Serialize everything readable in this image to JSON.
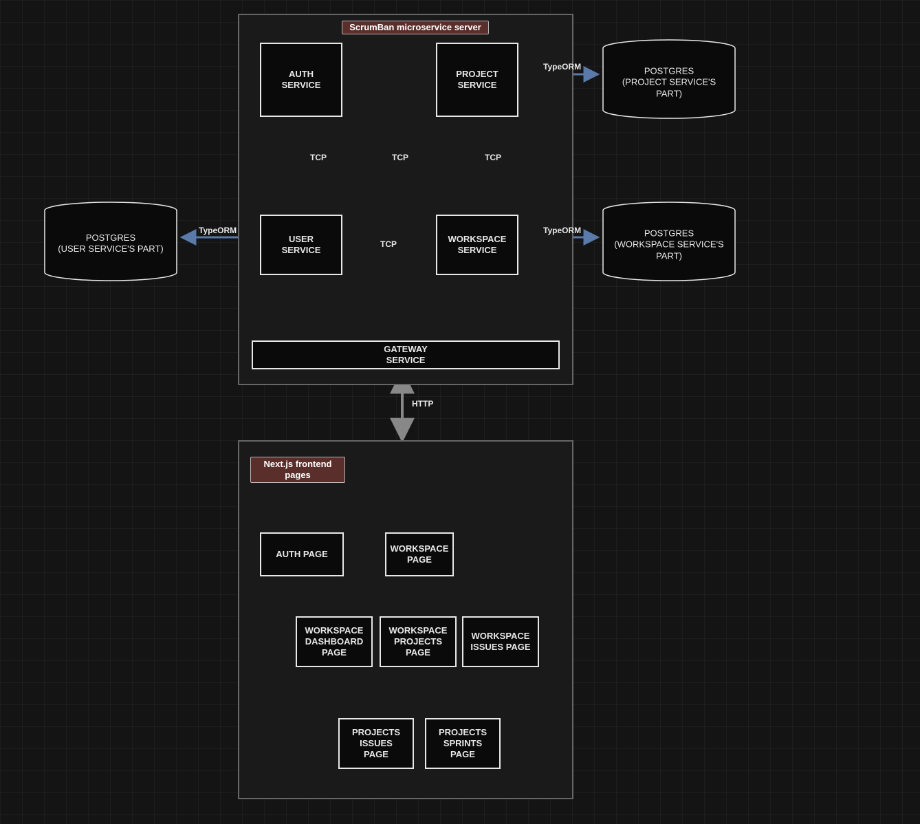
{
  "containers": {
    "server": {
      "title": "ScrumBan microservice server"
    },
    "frontend": {
      "title": "Next.js frontend pages"
    }
  },
  "services": {
    "auth": {
      "label": "AUTH\nSERVICE"
    },
    "project": {
      "label": "PROJECT\nSERVICE"
    },
    "user": {
      "label": "USER\nSERVICE"
    },
    "workspace": {
      "label": "WORKSPACE\nSERVICE"
    },
    "gateway": {
      "label": "GATEWAY\nSERVICE"
    }
  },
  "pages": {
    "auth": {
      "label": "AUTH PAGE"
    },
    "workspace": {
      "label": "WORKSPACE\nPAGE"
    },
    "ws_dashboard": {
      "label": "WORKSPACE\nDASHBOARD\nPAGE"
    },
    "ws_projects": {
      "label": "WORKSPACE\nPROJECTS\nPAGE"
    },
    "ws_issues": {
      "label": "WORKSPACE\nISSUES PAGE"
    },
    "proj_issues": {
      "label": "PROJECTS\nISSUES\nPAGE"
    },
    "proj_sprints": {
      "label": "PROJECTS\nSPRINTS\nPAGE"
    }
  },
  "databases": {
    "project": {
      "label": "POSTGRES\n(PROJECT SERVICE'S\nPART)"
    },
    "user": {
      "label": "POSTGRES\n(USER SERVICE'S PART)"
    },
    "workspace": {
      "label": "POSTGRES\n(WORKSPACE SERVICE'S\nPART)"
    }
  },
  "edge_labels": {
    "tcp1": "TCP",
    "tcp2": "TCP",
    "tcp3": "TCP",
    "tcp4": "TCP",
    "typeorm1": "TypeORM",
    "typeorm2": "TypeORM",
    "typeorm3": "TypeORM",
    "http": "HTTP"
  },
  "colors": {
    "dashed_arrow": "#d98b82",
    "blue_arrow": "#5a7aa9",
    "white_arrow": "#e8e8e8",
    "gray_arrow": "#888"
  }
}
